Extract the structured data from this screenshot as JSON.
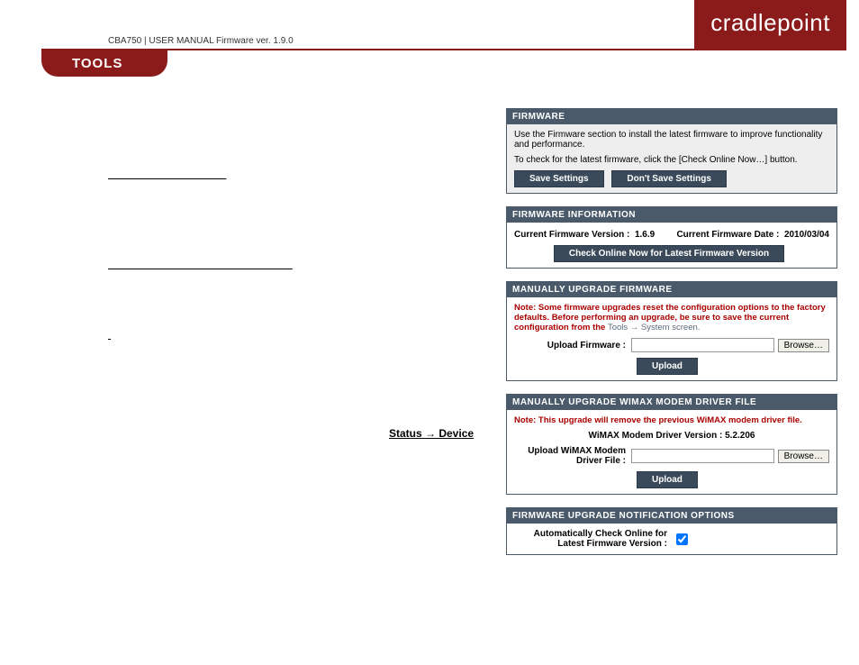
{
  "header": {
    "crumb": "CBA750 | USER MANUAL Firmware ver. 1.9.0",
    "logo": "cradlepoint",
    "tabLabel": "TOOLS"
  },
  "left": {
    "link1": "",
    "status_hd": "Status → Device"
  },
  "firmware": {
    "title": "FIRMWARE",
    "intro1": "Use the Firmware section to install the latest firmware to improve functionality and performance.",
    "intro2": "To check for the latest firmware, click the [Check Online Now…] button.",
    "save": "Save Settings",
    "dontsave": "Don't Save Settings"
  },
  "fwinfo": {
    "title": "FIRMWARE INFORMATION",
    "curVerLabel": "Current Firmware Version :",
    "curVer": "1.6.9",
    "curDateLabel": "Current Firmware Date :",
    "curDate": "2010/03/04",
    "checkBtn": "Check Online Now for Latest Firmware Version"
  },
  "manual": {
    "title": "MANUALLY UPGRADE FIRMWARE",
    "warn1": "Note: Some firmware upgrades reset the configuration options to the factory defaults. Before performing an upgrade, be sure to save the current configuration from the ",
    "warn2": "Tools → System",
    "warn3": " screen.",
    "uploadLabel": "Upload Firmware :",
    "browse": "Browse…",
    "upload": "Upload"
  },
  "wimax": {
    "title": "MANUALLY UPGRADE WIMAX MODEM DRIVER FILE",
    "warn": "Note: This upgrade will remove the previous WiMAX modem driver file.",
    "verLabel": "WiMAX Modem Driver Version : 5.2.206",
    "uploadLabel": "Upload WiMAX Modem Driver File :",
    "browse": "Browse…",
    "upload": "Upload"
  },
  "notify": {
    "title": "FIRMWARE UPGRADE NOTIFICATION OPTIONS",
    "label": "Automatically Check Online for Latest Firmware Version :"
  }
}
